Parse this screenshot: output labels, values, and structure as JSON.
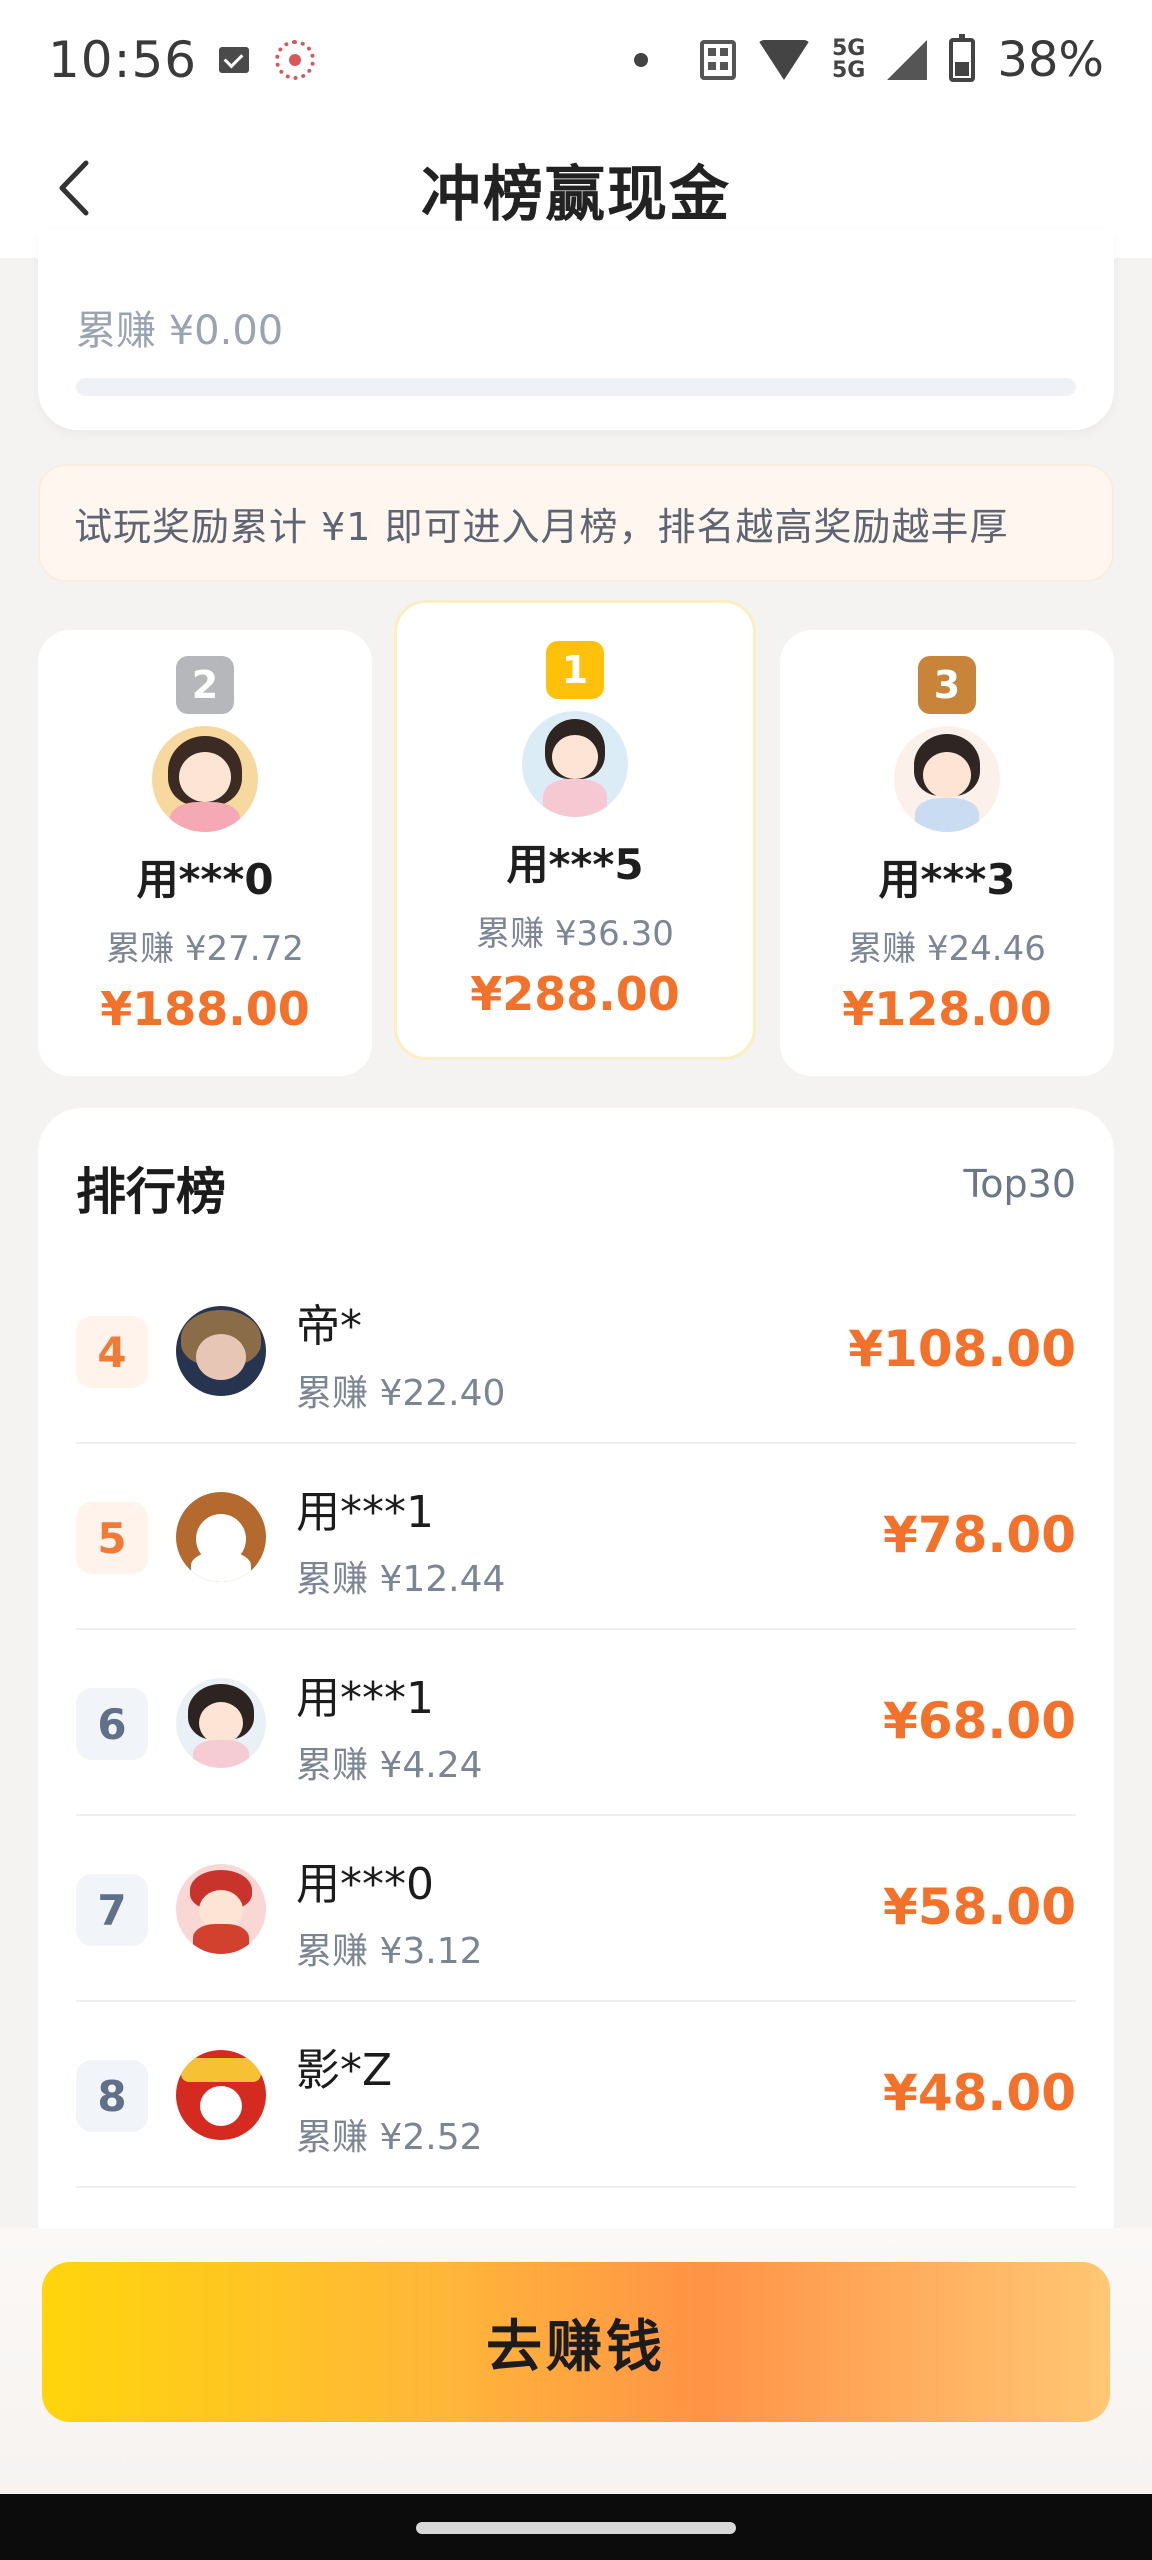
{
  "status_bar": {
    "time": "10:56",
    "network": "5G\n5G",
    "battery": "38%"
  },
  "header": {
    "title": "冲榜赢现金"
  },
  "summary": {
    "earned_text": "累赚 ¥0.00",
    "progress_fraction": 0
  },
  "notice": {
    "text": "试玩奖励累计 ¥1 即可进入月榜，排名越高奖励越丰厚"
  },
  "podium": [
    {
      "rank": "2",
      "name": "用***0",
      "earned": "累赚 ¥27.72",
      "prize": "¥188.00"
    },
    {
      "rank": "1",
      "name": "用***5",
      "earned": "累赚 ¥36.30",
      "prize": "¥288.00"
    },
    {
      "rank": "3",
      "name": "用***3",
      "earned": "累赚 ¥24.46",
      "prize": "¥128.00"
    }
  ],
  "ranking": {
    "title": "排行榜",
    "scope": "Top30",
    "rows": [
      {
        "rank": "4",
        "name": "帝*",
        "earned": "累赚 ¥22.40",
        "prize": "¥108.00"
      },
      {
        "rank": "5",
        "name": "用***1",
        "earned": "累赚 ¥12.44",
        "prize": "¥78.00"
      },
      {
        "rank": "6",
        "name": "用***1",
        "earned": "累赚 ¥4.24",
        "prize": "¥68.00"
      },
      {
        "rank": "7",
        "name": "用***0",
        "earned": "累赚 ¥3.12",
        "prize": "¥58.00"
      },
      {
        "rank": "8",
        "name": "影*Z",
        "earned": "累赚 ¥2.52",
        "prize": "¥48.00"
      }
    ]
  },
  "cta": {
    "label": "去赚钱"
  },
  "colors": {
    "prize": "#f2722b",
    "gold": "#ffc10a",
    "silver": "#b5b7ba",
    "bronze": "#c8853a"
  }
}
